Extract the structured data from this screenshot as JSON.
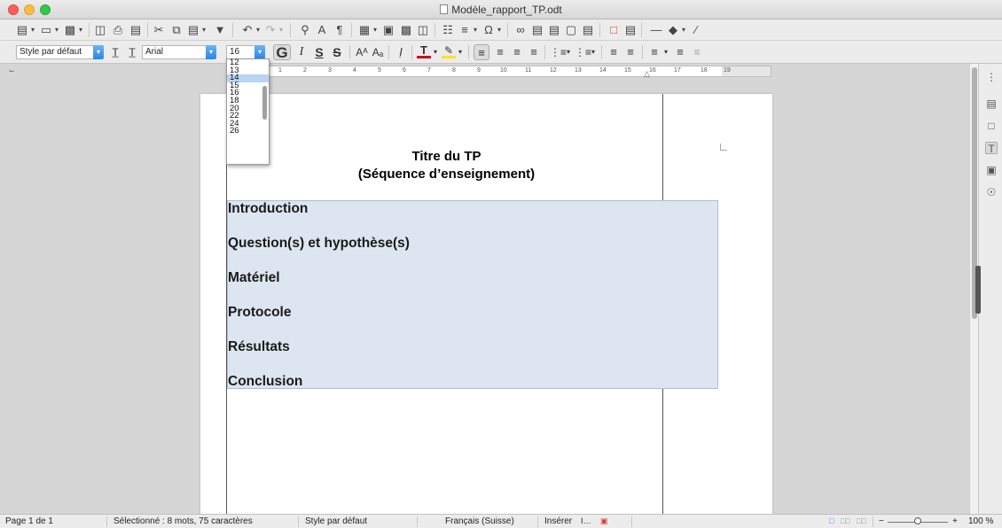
{
  "window": {
    "title": "Modèle_rapport_TP.odt"
  },
  "toolbar2": {
    "paragraph_style": "Style par défaut",
    "font_name": "Arial",
    "font_size": "16",
    "bold_label": "G",
    "italic_label": "I",
    "underline_label": "S",
    "strike_label": "S"
  },
  "font_size_dropdown": {
    "options": [
      "12",
      "13",
      "14",
      "15",
      "16",
      "18",
      "20",
      "22",
      "24",
      "26"
    ],
    "highlighted": "14"
  },
  "ruler": {
    "marks": [
      "1",
      "2",
      "3",
      "4",
      "5",
      "6",
      "7",
      "8",
      "9",
      "10",
      "11",
      "12",
      "13",
      "14",
      "15",
      "16",
      "17",
      "18",
      "19"
    ]
  },
  "document": {
    "title_line1": "Titre du TP",
    "title_line2": "(Séquence d’enseignement)",
    "sections": [
      "Introduction",
      "Question(s) et hypothèse(s)",
      "Matériel",
      "Protocole",
      "Résultats",
      "Conclusion"
    ]
  },
  "statusbar": {
    "page": "Page 1 de 1",
    "selection": "Sélectionné : 8 mots, 75 caractères",
    "style": "Style par défaut",
    "language": "Français (Suisse)",
    "mode": "Insérer",
    "zoom": "100 %"
  }
}
